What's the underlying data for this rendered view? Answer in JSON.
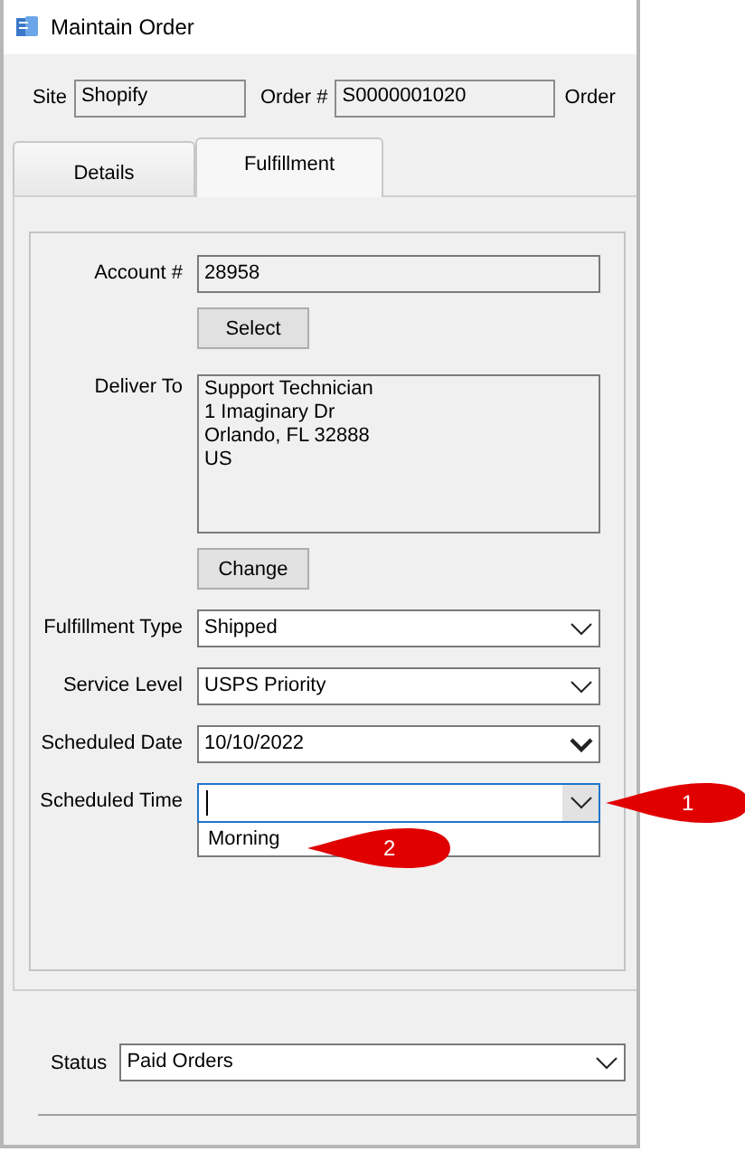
{
  "window": {
    "title": "Maintain Order"
  },
  "header": [
    {
      "label": "Site",
      "value": "Shopify"
    },
    {
      "label": "Order #",
      "value": "S0000001020"
    },
    {
      "label": "Order"
    }
  ],
  "tabs": [
    {
      "label": "Details",
      "selected": false
    },
    {
      "label": "Fulfillment",
      "selected": true
    }
  ],
  "form": {
    "rows": [
      {
        "kind": "text",
        "label": "Account #",
        "value": "28958"
      },
      {
        "kind": "button",
        "label": "Select"
      },
      {
        "kind": "address",
        "label": "Deliver To",
        "lines": [
          "Support Technician",
          "1 Imaginary Dr",
          "Orlando, FL  32888",
          "US"
        ]
      },
      {
        "kind": "button",
        "label": "Change"
      },
      {
        "kind": "combo",
        "label": "Fulfillment Type",
        "value": "Shipped"
      },
      {
        "kind": "combo",
        "label": "Service Level",
        "value": "USPS Priority"
      },
      {
        "kind": "date",
        "label": "Scheduled Date",
        "value": "10/10/2022"
      },
      {
        "kind": "combo",
        "label": "Scheduled Time",
        "focused": true,
        "expanded": true,
        "callout": "1",
        "options": [
          {
            "label": "Morning",
            "callout": "2"
          }
        ]
      }
    ]
  },
  "status": {
    "label": "Status",
    "value": "Paid Orders"
  }
}
